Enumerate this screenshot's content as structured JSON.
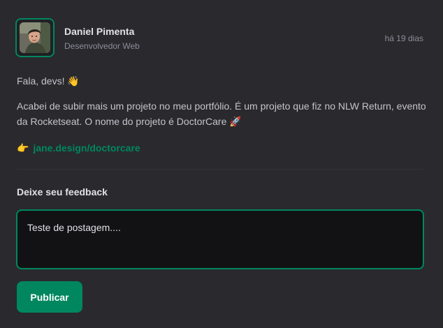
{
  "post": {
    "author": {
      "name": "Daniel Pimenta",
      "role": "Desenvolvedor Web"
    },
    "published_at": "há 19 dias",
    "content": {
      "greeting": "Fala, devs! 👋",
      "description": "Acabei de subir mais um projeto no meu portfólio. É um projeto que fiz no NLW Return, evento da Rocketseat. O nome do projeto é DoctorCare 🚀",
      "link_emoji": "👉",
      "link_text": "jane.design/doctorcare"
    }
  },
  "feedback": {
    "title": "Deixe seu feedback",
    "comment_value": "Teste de postagem....",
    "publish_label": "Publicar"
  },
  "colors": {
    "accent": "#00875f",
    "background": "#29292e",
    "input_background": "#121214"
  },
  "icons": {
    "avatar": "avatar-photo"
  }
}
